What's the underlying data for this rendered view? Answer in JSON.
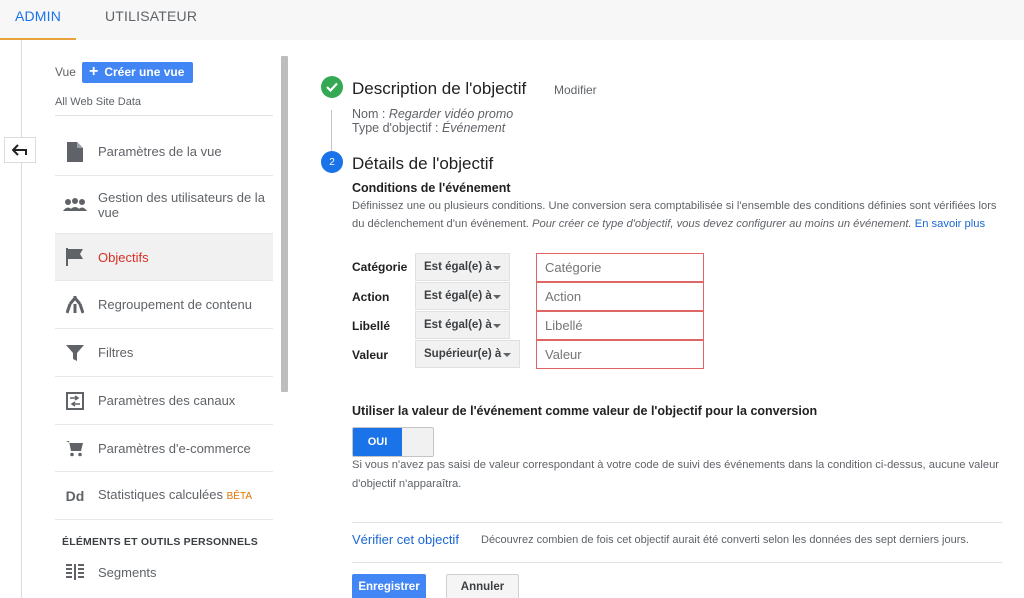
{
  "tabs": {
    "admin": "ADMIN",
    "user": "UTILISATEUR"
  },
  "view": {
    "label": "Vue",
    "create_button": "Créer une vue",
    "account_name": "All Web Site Data"
  },
  "nav": {
    "items": [
      {
        "label": "Paramètres de la vue",
        "icon": "document-icon"
      },
      {
        "label": "Gestion des utilisateurs de la vue",
        "icon": "users-icon"
      },
      {
        "label": "Objectifs",
        "icon": "flag-icon",
        "active": true
      },
      {
        "label": "Regroupement de contenu",
        "icon": "merge-icon"
      },
      {
        "label": "Filtres",
        "icon": "filter-icon"
      },
      {
        "label": "Paramètres des canaux",
        "icon": "channels-icon"
      },
      {
        "label": "Paramètres d'e-commerce",
        "icon": "cart-icon"
      },
      {
        "label": "Statistiques calculées",
        "badge": "BÊTA",
        "icon": "dd-icon"
      }
    ],
    "section_title": "ÉLÉMENTS ET OUTILS PERSONNELS",
    "segments": {
      "label": "Segments",
      "icon": "segments-icon"
    }
  },
  "goal_description": {
    "title": "Description de l'objectif",
    "modify": "Modifier",
    "name_label": "Nom : ",
    "name_value": "Regarder vidéo promo",
    "type_label": "Type d'objectif : ",
    "type_value": "Événement"
  },
  "goal_details": {
    "step_number": "2",
    "title": "Détails de l'objectif",
    "conditions_title": "Conditions de l'événement",
    "conditions_desc": "Définissez une ou plusieurs conditions. Une conversion sera comptabilisée si l'ensemble des conditions définies sont vérifiées lors du déclenchement d'un événement. ",
    "conditions_desc_italic": "Pour créer ce type d'objectif, vous devez configurer au moins un événement.",
    "learn_more": "En savoir plus",
    "conditions": [
      {
        "label": "Catégorie",
        "operator": "Est égal(e) à",
        "placeholder": "Catégorie"
      },
      {
        "label": "Action",
        "operator": "Est égal(e) à",
        "placeholder": "Action"
      },
      {
        "label": "Libellé",
        "operator": "Est égal(e) à",
        "placeholder": "Libellé"
      },
      {
        "label": "Valeur",
        "operator": "Supérieur(e) à",
        "placeholder": "Valeur"
      }
    ],
    "use_value_title": "Utiliser la valeur de l'événement comme valeur de l'objectif pour la conversion",
    "toggle_label": "OUI",
    "toggle_hint": "Si vous n'avez pas saisi de valeur correspondant à votre code de suivi des événements dans la condition ci-dessus, aucune valeur d'objectif n'apparaîtra."
  },
  "verify": {
    "link": "Vérifier cet objectif",
    "desc": "Découvrez combien de fois cet objectif aurait été converti selon les données des sept derniers jours."
  },
  "actions": {
    "save": "Enregistrer",
    "cancel": "Annuler"
  },
  "colors": {
    "accent": "#1a73e8",
    "active_nav": "#d93025",
    "check": "#34a853",
    "input_border": "#e06666"
  }
}
